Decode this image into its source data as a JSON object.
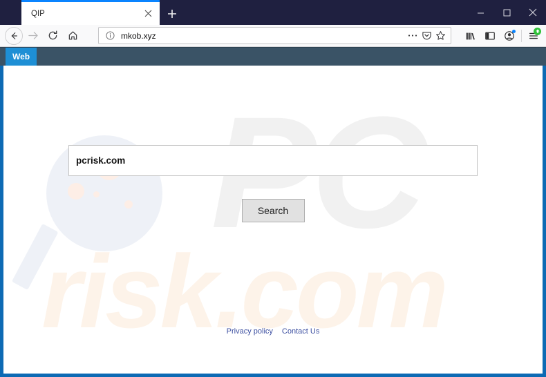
{
  "browser": {
    "tab": {
      "title": "QIP",
      "close_icon": "close-icon"
    },
    "new_tab_label": "+",
    "window_controls": {
      "minimize": "minimize-icon",
      "maximize": "maximize-icon",
      "close": "close-icon"
    },
    "nav": {
      "back": "back-arrow-icon",
      "forward": "forward-arrow-icon",
      "reload": "reload-icon",
      "home": "home-icon"
    },
    "urlbar": {
      "identity_icon": "info-circle-icon",
      "value": "mkob.xyz",
      "placeholder": "Search or enter address",
      "page_actions_icon": "ellipsis-icon",
      "pocket_icon": "pocket-icon",
      "bookmark_icon": "star-icon"
    },
    "toolbar_right": {
      "library": "library-icon",
      "sidebar": "sidebar-icon",
      "account": "account-icon",
      "menu": "hamburger-menu-icon"
    }
  },
  "site": {
    "nav_tabs": [
      {
        "label": "Web"
      }
    ],
    "search": {
      "value": "pcrisk.com",
      "placeholder": "",
      "button_label": "Search"
    },
    "footer": {
      "links": [
        {
          "label": "Privacy policy"
        },
        {
          "label": "Contact Us"
        }
      ]
    },
    "watermark": {
      "top_text": "PC",
      "bottom_text": "risk.com"
    }
  },
  "colors": {
    "titlebar": "#1f2040",
    "frame": "#0d6ab4",
    "tab_accent": "#0a84ff",
    "sitenav_bg": "#3a5366",
    "sitenav_tab": "#1e8fd5",
    "link": "#3b4ea0",
    "watermark_gray": "#f1f1f1",
    "watermark_cream": "#fdf3e9"
  }
}
